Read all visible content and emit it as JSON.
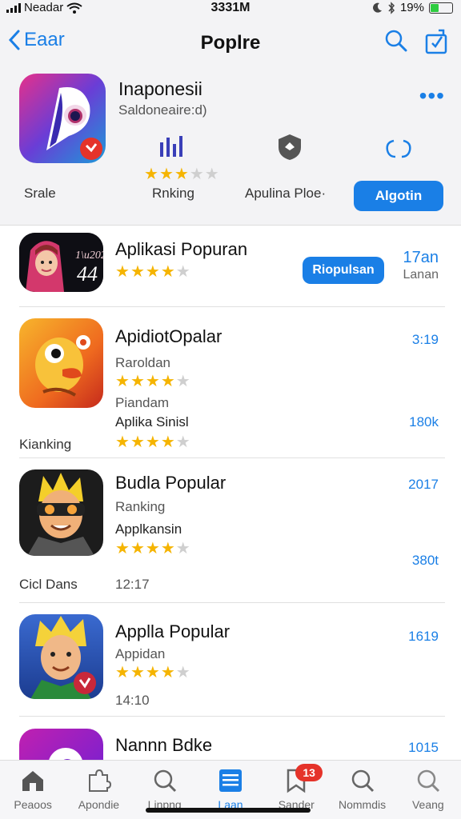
{
  "status_bar": {
    "carrier": "Neadar",
    "time": "3331M",
    "battery": "19%"
  },
  "nav": {
    "back_label": "Eaar",
    "title": "Poplre"
  },
  "featured": {
    "name": "Inaponesii",
    "subtitle": "Saldoneaire:d)",
    "rating": 3,
    "labels": {
      "scale": "Srale",
      "ranking": "Rnking",
      "applina": "Apulina Ploe·"
    },
    "get_label": "Algotin"
  },
  "apps": [
    {
      "title": "Aplikasi Popuran",
      "lines": [],
      "rating": 4,
      "button": "Riopulsan",
      "right": [
        "17an",
        "Lanan"
      ],
      "left_label": "",
      "icon_text": "1 gs 44"
    },
    {
      "title": "ApidiotOpalar",
      "lines": [
        "Raroldan",
        "Piandam",
        "Aplika Sinisl"
      ],
      "rating": 4,
      "rating2": 4,
      "right": [
        "3:19",
        "180k"
      ],
      "left_label": "Kianking"
    },
    {
      "title": "Budla Popular",
      "lines": [
        "Ranking",
        "Applkansin"
      ],
      "rating": 4,
      "right": [
        "2017",
        "380t"
      ],
      "left_label": "Cicl Dans",
      "extra": "12:17"
    },
    {
      "title": "Applla Popular",
      "lines": [
        "Appidan"
      ],
      "rating": 4,
      "right": [
        "1619"
      ],
      "time": "14:10"
    },
    {
      "title": "Nannn Bdke",
      "right": [
        "1015"
      ]
    }
  ],
  "tabs": [
    {
      "label": "Peaoos",
      "icon": "home-icon"
    },
    {
      "label": "Apondie",
      "icon": "puzzle-icon"
    },
    {
      "label": "Linpng",
      "icon": "search-icon"
    },
    {
      "label": "Laan",
      "icon": "list-icon",
      "active": true
    },
    {
      "label": "Sander",
      "icon": "bookmark-icon",
      "badge": "13"
    },
    {
      "label": "Nommdis",
      "icon": "search-icon"
    },
    {
      "label": "Veang",
      "icon": "search-icon"
    }
  ],
  "colors": {
    "accent": "#1a7fe6",
    "star": "#f5b400",
    "badge": "#e5332a"
  }
}
